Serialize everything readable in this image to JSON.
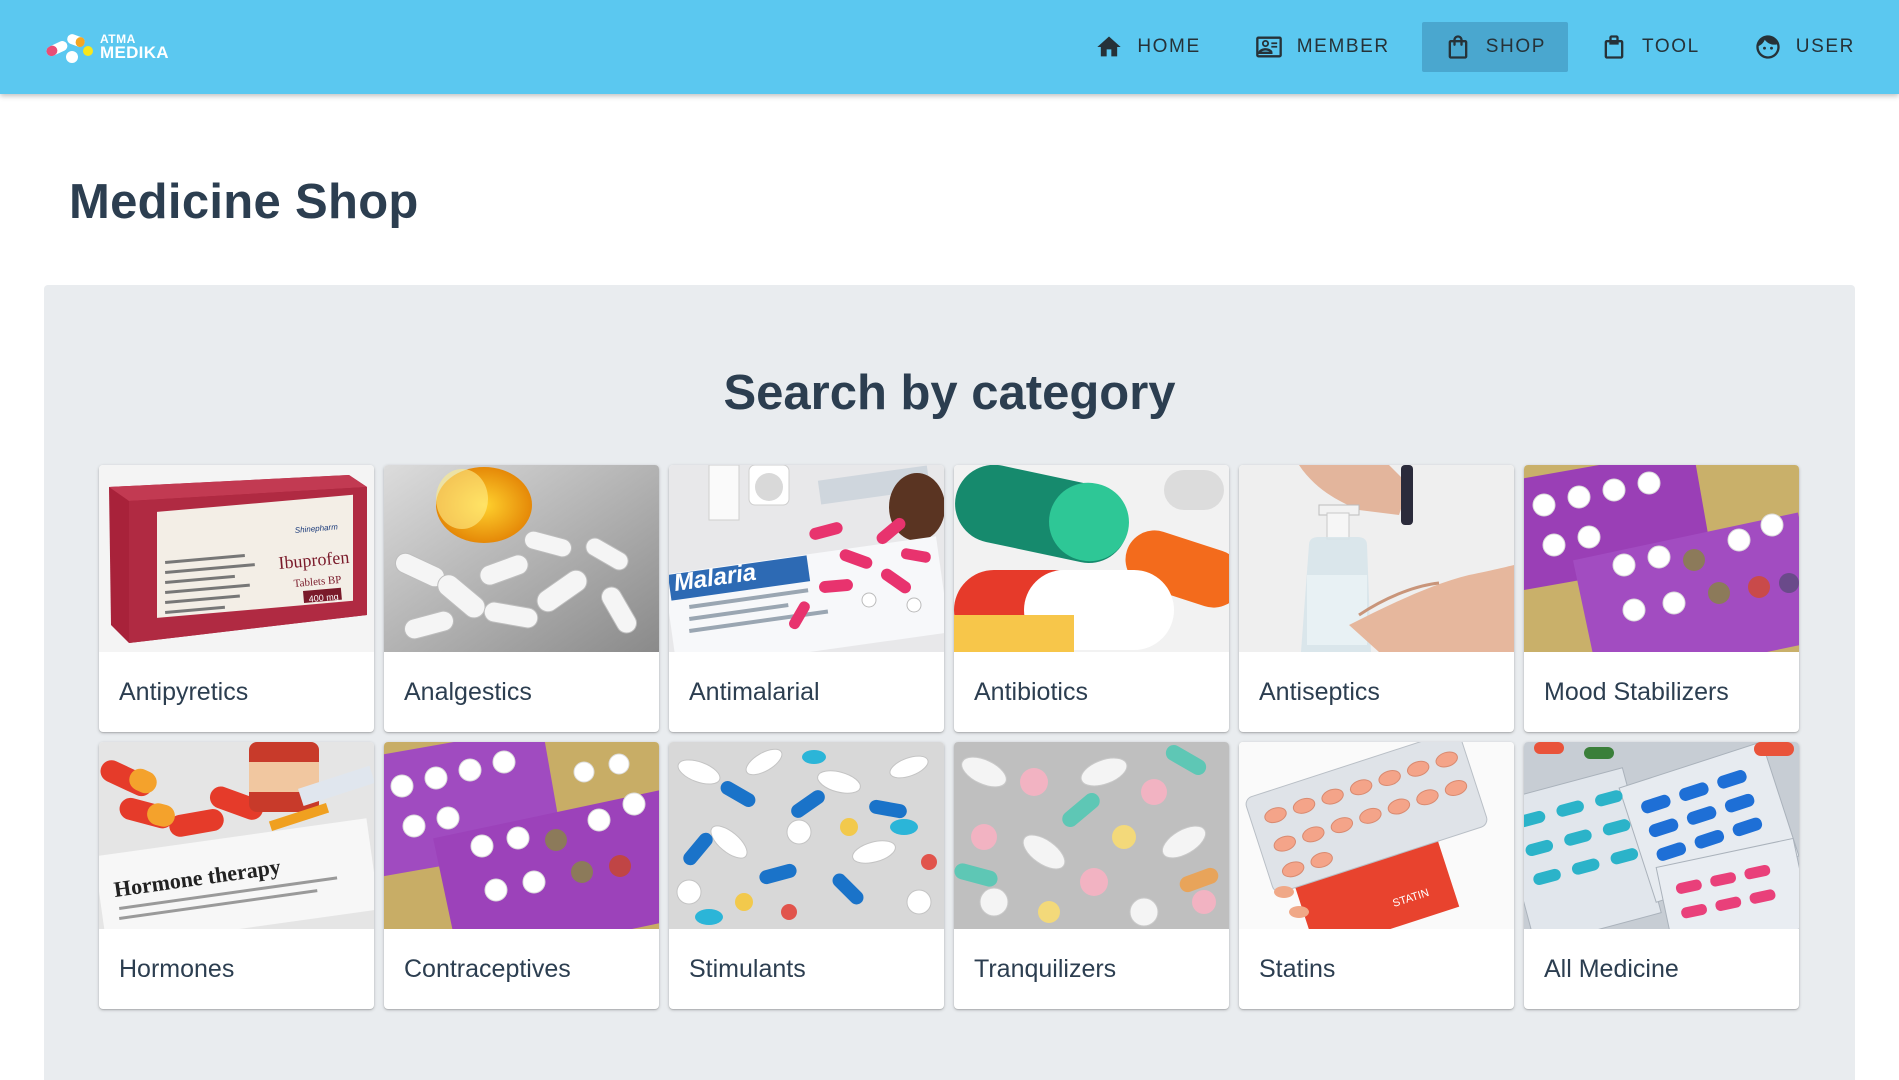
{
  "brand": {
    "line1": "ATMA",
    "line2": "MEDIKA"
  },
  "nav": [
    {
      "label": "HOME",
      "icon": "home-icon",
      "active": false
    },
    {
      "label": "MEMBER",
      "icon": "member-card-icon",
      "active": false
    },
    {
      "label": "SHOP",
      "icon": "shopping-bag-icon",
      "active": true
    },
    {
      "label": "TOOL",
      "icon": "clipboard-icon",
      "active": false
    },
    {
      "label": "USER",
      "icon": "user-face-icon",
      "active": false
    }
  ],
  "page": {
    "title": "Medicine Shop"
  },
  "categories_section": {
    "title": "Search by category",
    "items": [
      {
        "label": "Antipyretics",
        "image": "ibuprofen-box-image",
        "image_text": [
          "Ibuprofen",
          "Tablets BP",
          "400 mg",
          "Shinepharm"
        ]
      },
      {
        "label": "Analgestics",
        "image": "white-pills-bottle-image"
      },
      {
        "label": "Antimalarial",
        "image": "malaria-pills-image",
        "image_text": [
          "Malaria"
        ]
      },
      {
        "label": "Antibiotics",
        "image": "capsules-closeup-image"
      },
      {
        "label": "Antiseptics",
        "image": "hand-sanitizer-image"
      },
      {
        "label": "Mood Stabilizers",
        "image": "purple-blister-pack-image"
      },
      {
        "label": "Hormones",
        "image": "hormone-therapy-image",
        "image_text": [
          "Hormone therapy"
        ]
      },
      {
        "label": "Contraceptives",
        "image": "contraceptive-pills-image"
      },
      {
        "label": "Stimulants",
        "image": "mixed-pills-blue-image"
      },
      {
        "label": "Tranquilizers",
        "image": "pastel-pills-image"
      },
      {
        "label": "Statins",
        "image": "statin-blister-image",
        "image_text": [
          "STATIN"
        ]
      },
      {
        "label": "All Medicine",
        "image": "assorted-blister-packs-image"
      }
    ]
  },
  "colors": {
    "appbar": "#5bc8f0",
    "appbar_active": "#4aa7cf",
    "panel": "#e9ecef",
    "text": "#2c3e50"
  }
}
